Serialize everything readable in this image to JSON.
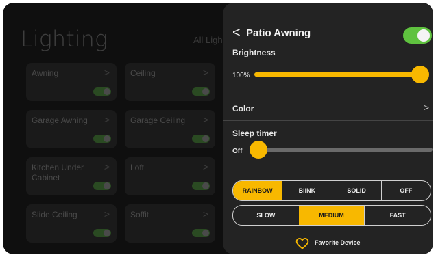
{
  "main": {
    "title": "Lighting",
    "filter_label": "All Ligh",
    "devices": [
      {
        "name": "Awning"
      },
      {
        "name": "Ceiling"
      },
      {
        "name": "Garage Awning"
      },
      {
        "name": "Garage Ceiling"
      },
      {
        "name": "Kitchen Under Cabinet"
      },
      {
        "name": "Loft"
      },
      {
        "name": "Slide Ceiling"
      },
      {
        "name": "Soffit"
      }
    ],
    "chevron": ">"
  },
  "panel": {
    "back_icon": "<",
    "title": "Patio Awning",
    "power_on": true,
    "brightness_label": "Brightness",
    "brightness_value_text": "100%",
    "brightness_level": 1.0,
    "color_label": "Color",
    "color_chevron": ">",
    "sleep_label": "Sleep timer",
    "sleep_value_text": "Off",
    "sleep_level": 0.0,
    "modes": [
      "RAINBOW",
      "BlINK",
      "SOLID",
      "OFF"
    ],
    "selected_mode": "RAINBOW",
    "speeds": [
      "SLOW",
      "MEDIUM",
      "FAST"
    ],
    "selected_speed": "MEDIUM",
    "favorite_label": "Favorite Device"
  },
  "colors": {
    "accent": "#f8b800",
    "toggle_on": "#5fc23f",
    "panel_bg": "#232323"
  }
}
